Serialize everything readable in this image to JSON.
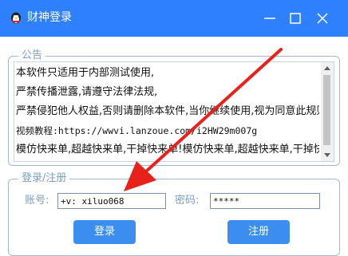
{
  "window": {
    "title": "财神登录",
    "accent": "#2f80ff"
  },
  "notice": {
    "legend": "公告",
    "lines": [
      "本软件只适用于内部测试使用,",
      "严禁传播泄露,请遵守法律法规,",
      "严禁侵犯他人权益,否则请删除本软件,当你继续使用,视为同意此规则!",
      "视频教程:https://wwvi.lanzoue.com/i2HW29m007g",
      "模仿快来单,超越快来单,干掉快来单!模仿快来单,超越快来单,干掉快来单!"
    ]
  },
  "login": {
    "legend": "登录/注册",
    "account_label": "账号:",
    "account_value": "+v: xiluo068",
    "password_label": "密码:",
    "password_value": "*****",
    "login_button": "登录",
    "register_button": "注册",
    "button_color": "#3b8ef0"
  },
  "annotation": {
    "arrow_color": "#e8211a",
    "arrow_icon": "red-arrow-icon"
  }
}
